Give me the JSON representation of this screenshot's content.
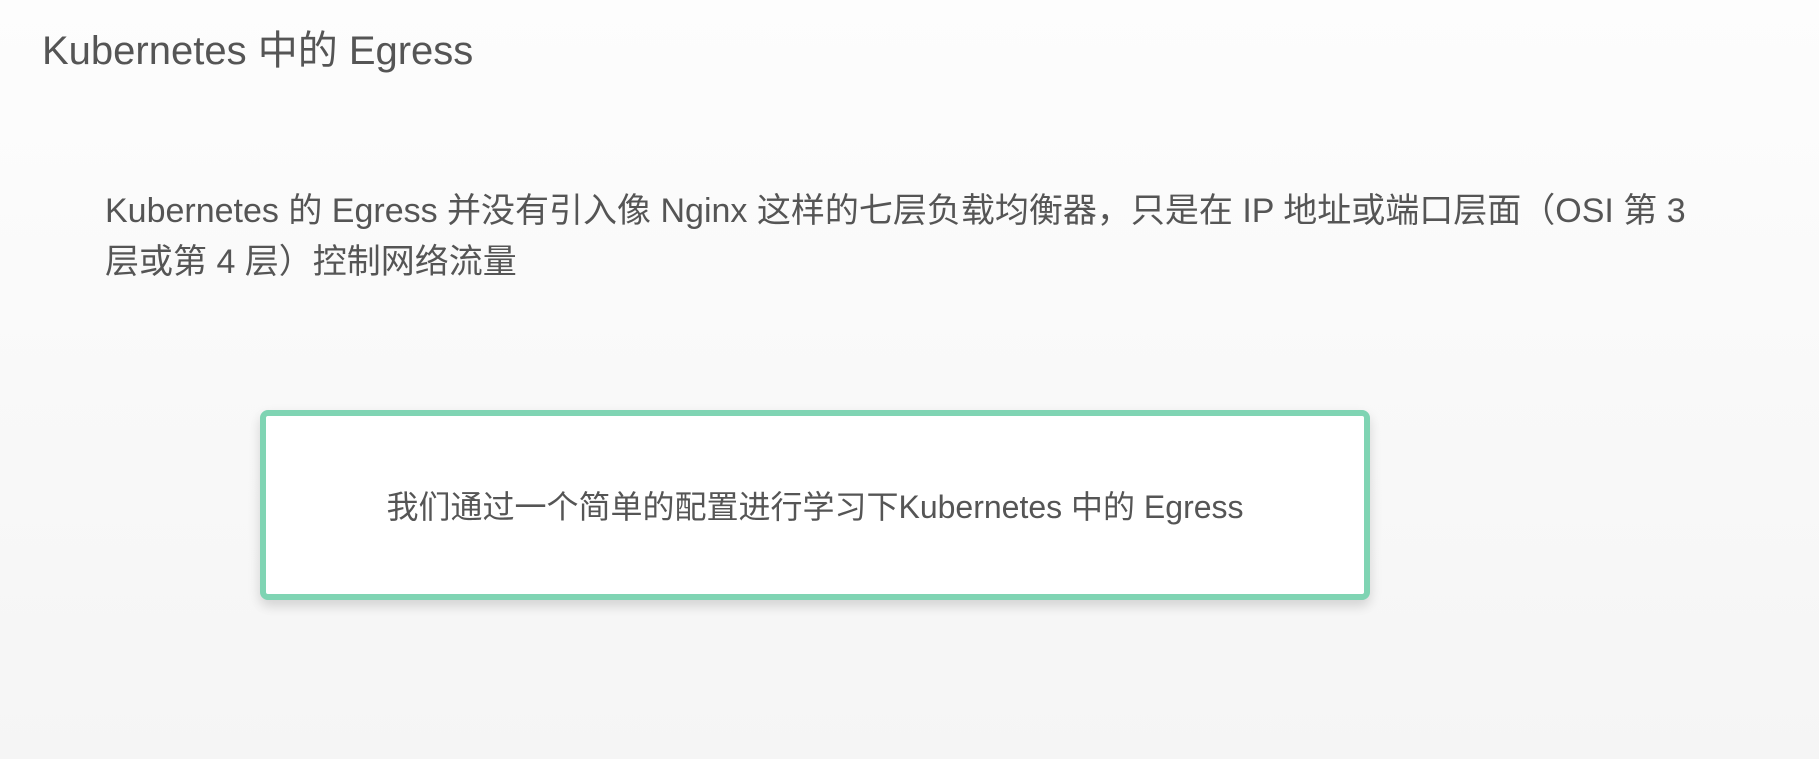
{
  "title": "Kubernetes 中的 Egress",
  "body": "Kubernetes 的 Egress 并没有引入像 Nginx 这样的七层负载均衡器，只是在 IP 地址或端口层面（OSI 第 3 层或第 4 层）控制网络流量",
  "callout": "我们通过一个简单的配置进行学习下Kubernetes 中的 Egress"
}
